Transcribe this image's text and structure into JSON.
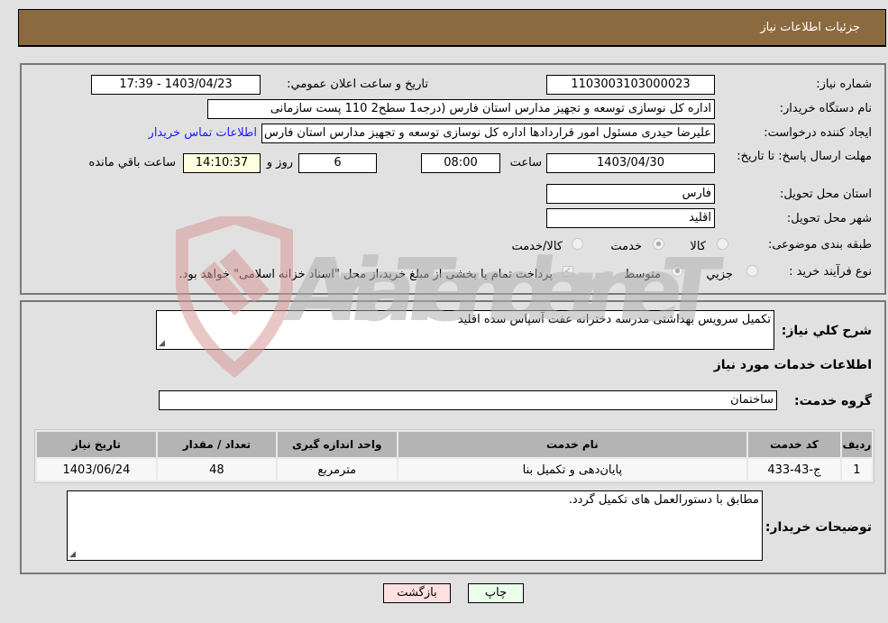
{
  "header": {
    "title": "جزئیات اطلاعات نیاز"
  },
  "form": {
    "need_number_label": "شماره نیاز:",
    "need_number": "1103003103000023",
    "announce_label": "تاریخ و ساعت اعلان عمومي:",
    "announce_value": "1403/04/23 - 17:39",
    "buyer_org_label": "نام دستگاه خريدار:",
    "buyer_org": "اداره کل نوسازی   توسعه و تجهیز مدارس استان فارس (درجه1  سطح2  110 پست سازمانی",
    "creator_label": "ايجاد کننده درخواست:",
    "creator": "علیرضا حیدری مسئول امور قراردادها اداره کل نوسازی   توسعه و تجهیز مدارس استان فارس",
    "contact_link": "اطلاعات تماس خريدار",
    "deadline_label": "مهلت ارسال پاسخ: تا تاريخ:",
    "deadline_date": "1403/04/30",
    "time_label": "ساعت",
    "deadline_time": "08:00",
    "days_value": "6",
    "days_label": "روز و",
    "remaining_time": "14:10:37",
    "remaining_label": "ساعت باقي مانده",
    "province_label": "استان محل تحويل:",
    "province": "فارس",
    "city_label": "شهر محل تحويل:",
    "city": "اقلید",
    "category_label": "طبقه بندی موضوعی:",
    "category_options": [
      {
        "label": "کالا",
        "selected": false
      },
      {
        "label": "خدمت",
        "selected": true
      },
      {
        "label": "کالا/خدمت",
        "selected": false
      }
    ],
    "process_label": "نوع فرآيند خريد :",
    "process_options": [
      {
        "label": "جزيي",
        "selected": false
      },
      {
        "label": "متوسط",
        "selected": true
      }
    ],
    "treasury_checked": true,
    "treasury_text": "پرداخت تمام يا بخشی از مبلغ خريد،از محل \"اسناد خزانه اسلامی\" خواهد بود."
  },
  "details": {
    "description_label": "شرح کلي نياز:",
    "description": "تکمیل سرویس بهداشتی مدرسه دخترانه عفت آسپاس سده اقلید",
    "services_title": "اطلاعات خدمات مورد نياز",
    "service_group_label": "گروه خدمت:",
    "service_group": "ساختمان",
    "table": {
      "columns": [
        "رديف",
        "کد خدمت",
        "نام خدمت",
        "واحد اندازه گيری",
        "تعداد / مقدار",
        "تاريخ نياز"
      ],
      "rows": [
        [
          "1",
          "ج-43-433",
          "پایان‌دهی و تکمیل بنا",
          "مترمربع",
          "48",
          "1403/06/24"
        ]
      ]
    },
    "buyer_notes_label": "توضيحات خريدار:",
    "buyer_notes": "مطابق با دستورالعمل های تکمیل گردد."
  },
  "buttons": {
    "print": "چاپ",
    "back": "بازگشت"
  },
  "watermark": {
    "text": "AriaTender.neT"
  },
  "colors": {
    "header_bg": "#8c6a3f",
    "link": "#1a1aff",
    "print_bg": "#eaffea",
    "back_bg": "#ffe0e0",
    "remaining_bg": "#ffffe0"
  }
}
